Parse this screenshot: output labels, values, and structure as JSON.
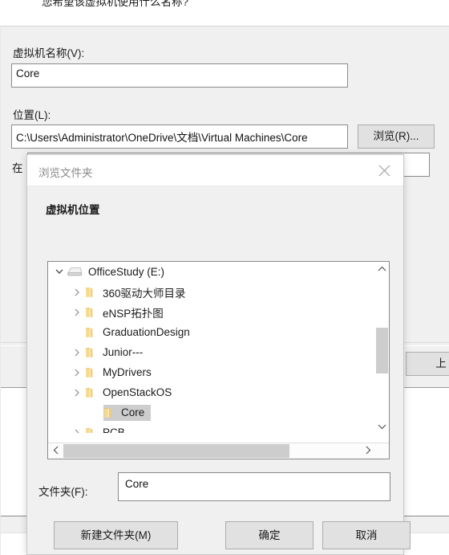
{
  "wizard": {
    "heading": "您希望该虚拟机使用什么名称?",
    "vm_name_label": "虚拟机名称(V):",
    "vm_name_value": "Core",
    "location_label": "位置(L):",
    "location_value": "C:\\Users\\Administrator\\OneDrive\\文档\\Virtual Machines\\Core",
    "browse_button": "浏览(R)...",
    "hint_label": "在",
    "hint_value": "",
    "back_button": "上"
  },
  "dialog": {
    "title": "浏览文件夹",
    "close_icon": "close-icon",
    "section_title": "虚拟机位置",
    "folder_label": "文件夹(F):",
    "folder_value": "Core",
    "buttons": {
      "new_folder": "新建文件夹(M)",
      "ok": "确定",
      "cancel": "取消"
    },
    "tree": [
      {
        "label": "OfficeStudy (E:)",
        "icon": "drive-icon",
        "indent": 0,
        "twisty": "expanded",
        "selected": false
      },
      {
        "label": "360驱动大师目录",
        "icon": "folder-icon",
        "indent": 1,
        "twisty": "collapsed",
        "selected": false
      },
      {
        "label": "eNSP拓扑图",
        "icon": "folder-icon",
        "indent": 1,
        "twisty": "collapsed",
        "selected": false
      },
      {
        "label": "GraduationDesign",
        "icon": "folder-icon",
        "indent": 1,
        "twisty": "none",
        "selected": false
      },
      {
        "label": "Junior---",
        "icon": "folder-icon",
        "indent": 1,
        "twisty": "collapsed",
        "selected": false
      },
      {
        "label": "MyDrivers",
        "icon": "folder-icon",
        "indent": 1,
        "twisty": "collapsed",
        "selected": false
      },
      {
        "label": "OpenStackOS",
        "icon": "folder-icon",
        "indent": 1,
        "twisty": "collapsed",
        "selected": false
      },
      {
        "label": "Core",
        "icon": "folder-icon",
        "indent": 2,
        "twisty": "none",
        "selected": true
      },
      {
        "label": "PCB",
        "icon": "folder-icon",
        "indent": 1,
        "twisty": "collapsed",
        "selected": false
      }
    ],
    "scrollbars": {
      "vertical_up_icon": "chevron-up-icon",
      "vertical_down_icon": "chevron-down-icon",
      "horizontal_left_icon": "chevron-left-icon",
      "horizontal_right_icon": "chevron-right-icon"
    }
  },
  "colors": {
    "folder": "#f5d37b",
    "folder_edge": "#e3b council",
    "selection": "#cdcdcd",
    "dialog_bg": "#f0f0f0",
    "button_bg": "#e1e1e1"
  }
}
